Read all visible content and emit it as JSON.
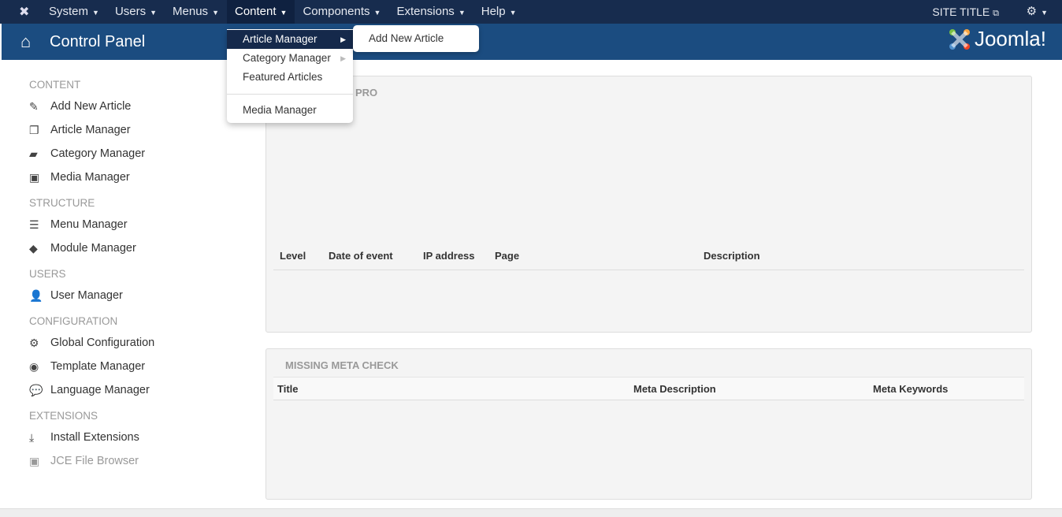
{
  "topbar": {
    "menus": [
      "System",
      "Users",
      "Menus",
      "Content",
      "Components",
      "Extensions",
      "Help"
    ],
    "active": "Content",
    "site_title": "SITE TITLE"
  },
  "header": {
    "title": "Control Panel",
    "brand": "Joomla!"
  },
  "dropdown": {
    "items": [
      "Article Manager",
      "Category Manager",
      "Featured Articles",
      "Media Manager"
    ],
    "submenu": "Add New Article"
  },
  "sidebar": {
    "content": {
      "heading": "CONTENT",
      "items": [
        "Add New Article",
        "Article Manager",
        "Category Manager",
        "Media Manager"
      ]
    },
    "structure": {
      "heading": "STRUCTURE",
      "items": [
        "Menu Manager",
        "Module Manager"
      ]
    },
    "users": {
      "heading": "USERS",
      "items": [
        "User Manager"
      ]
    },
    "configuration": {
      "heading": "CONFIGURATION",
      "items": [
        "Global Configuration",
        "Template Manager",
        "Language Manager"
      ]
    },
    "extensions": {
      "heading": "EXTENSIONS",
      "items": [
        "Install Extensions",
        "JCE File Browser"
      ]
    }
  },
  "panel1": {
    "title_visible": "PRO",
    "columns": [
      "Level",
      "Date of event",
      "IP address",
      "Page",
      "Description"
    ]
  },
  "panel2": {
    "title": "MISSING META CHECK",
    "columns": [
      "Title",
      "Meta Description",
      "Meta Keywords"
    ]
  }
}
